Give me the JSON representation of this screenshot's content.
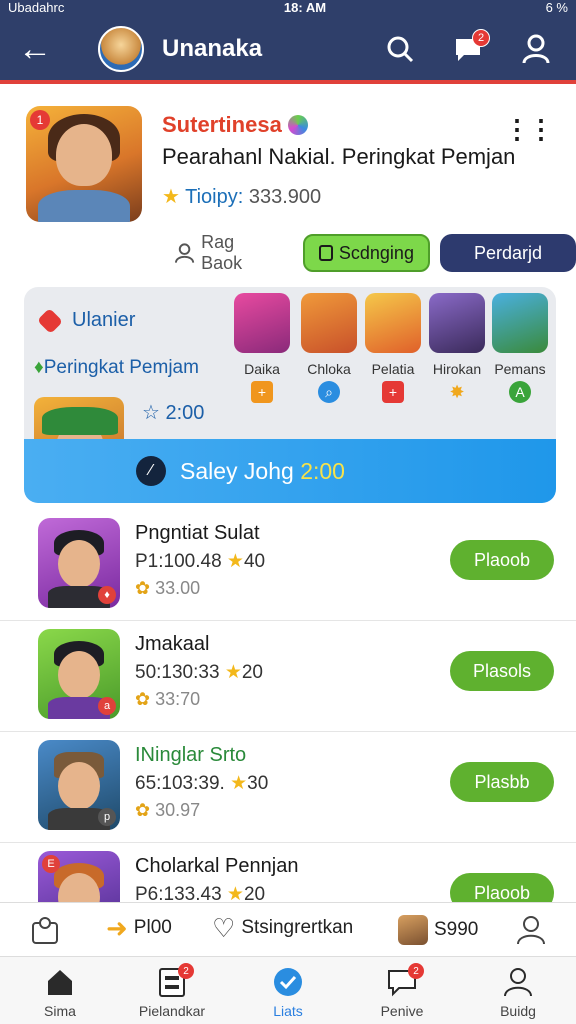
{
  "status": {
    "left": "Ubadahrc",
    "time": "18: AM",
    "right": "6 %"
  },
  "header": {
    "title": "Unanaka",
    "chat_badge": "2"
  },
  "profile": {
    "rank_badge": "1",
    "name": "Sutertinesa",
    "subtitle": "Pearahanl Nakial. Peringkat Pemjan",
    "trophy_label": "Tioipy:",
    "trophy_value": "333.900",
    "ghost_label": "Rag Baok",
    "green_button": "Scdnging",
    "navy_button": "Perdarjd"
  },
  "card": {
    "title": "Ulanier",
    "subtitle": "Peringkat Pemjam",
    "timer": "2:00",
    "banner_text": "Saley Johg ",
    "banner_highlight": "2:00",
    "characters": [
      {
        "name": "Daika",
        "mark": "+",
        "color": "#f0961e"
      },
      {
        "name": "Chloka",
        "mark": "⌕",
        "color": "#2a8de0"
      },
      {
        "name": "Pelatia",
        "mark": "+",
        "color": "#e53935"
      },
      {
        "name": "Hirokan",
        "mark": "✸",
        "color": "#f0a81e"
      },
      {
        "name": "Pemans",
        "mark": "A",
        "color": "#3aa43a"
      }
    ]
  },
  "rows": [
    {
      "name": "Pngntiat Sulat",
      "stat": "P1:100.48",
      "stars": "40",
      "score": "33.00",
      "play": "Plaoob",
      "bg": "#a03ccf",
      "mini": "♦"
    },
    {
      "name": "Jmakaal",
      "stat": "50:130:33",
      "stars": "20",
      "score": "33:70",
      "play": "Plasols",
      "bg": "#6abf3a",
      "mini": "a"
    },
    {
      "name": "INinglar Srto",
      "stat": "65:103:39.",
      "stars": "30",
      "score": "30.97",
      "play": "Plasbb",
      "bg": "#2e6a9e",
      "mini": "p"
    },
    {
      "name": "Cholarkal Pennjan",
      "stat": "P6:133.43",
      "stars": "20",
      "score": "",
      "play": "Plaoob",
      "bg": "#7a3cc0",
      "mini": "E"
    }
  ],
  "quickbar": {
    "item1": "Pl00",
    "item2": "Stsingrertkan",
    "item3": "S990"
  },
  "nav": [
    {
      "label": "Sima",
      "icon": "home-icon",
      "badge": ""
    },
    {
      "label": "Pielandkar",
      "icon": "cabinet-icon",
      "badge": "2"
    },
    {
      "label": "Liats",
      "icon": "check-icon",
      "badge": ""
    },
    {
      "label": "Penive",
      "icon": "chat-icon",
      "badge": "2"
    },
    {
      "label": "Buidg",
      "icon": "user-icon",
      "badge": ""
    }
  ]
}
